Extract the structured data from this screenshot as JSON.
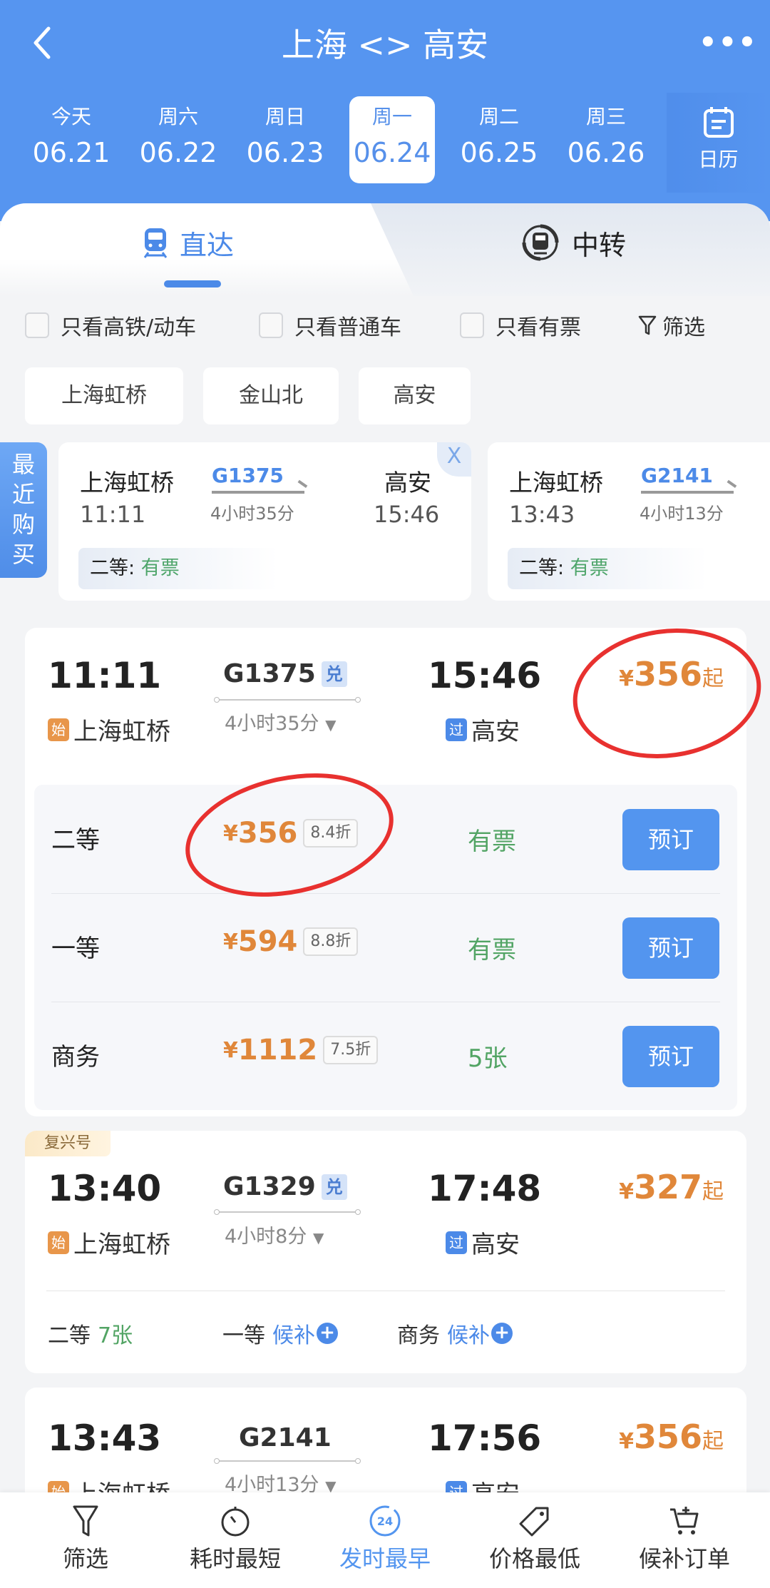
{
  "header": {
    "title": "上海 <> 高安",
    "back_icon": "chevron-left-icon",
    "more_icon": "more-dots-icon",
    "more_label": "•••"
  },
  "dates": [
    {
      "weekday": "今天",
      "date": "06.21",
      "selected": false
    },
    {
      "weekday": "周六",
      "date": "06.22",
      "selected": false
    },
    {
      "weekday": "周日",
      "date": "06.23",
      "selected": false
    },
    {
      "weekday": "周一",
      "date": "06.24",
      "selected": true
    },
    {
      "weekday": "周二",
      "date": "06.25",
      "selected": false
    },
    {
      "weekday": "周三",
      "date": "06.26",
      "selected": false
    }
  ],
  "calendar": {
    "label": "日历",
    "icon": "calendar-icon"
  },
  "tabs": [
    {
      "label": "直达",
      "icon": "train-icon",
      "active": true
    },
    {
      "label": "中转",
      "icon": "transfer-train-icon",
      "active": false
    }
  ],
  "filters": {
    "checkboxes": [
      {
        "label": "只看高铁/动车",
        "checked": false
      },
      {
        "label": "只看普通车",
        "checked": false
      },
      {
        "label": "只看有票",
        "checked": false
      }
    ],
    "filter_label": "筛选"
  },
  "stations": [
    "上海虹桥",
    "金山北",
    "高安"
  ],
  "recent": {
    "tab_label": "最近购买",
    "close_label": "X",
    "items": [
      {
        "from": "上海虹桥",
        "from_time": "11:11",
        "train": "G1375",
        "duration": "4小时35分",
        "to": "高安",
        "to_time": "15:46",
        "seat": "二等:",
        "availability": "有票"
      },
      {
        "from": "上海虹桥",
        "from_time": "13:43",
        "train": "G2141",
        "duration": "4小时13分",
        "seat": "二等:",
        "availability": "有票"
      }
    ]
  },
  "trains": [
    {
      "dep_time": "11:11",
      "train_no": "G1375",
      "tag": "兑",
      "duration": "4小时35分",
      "arr_time": "15:46",
      "from_badge": "始",
      "from": "上海虹桥",
      "to_badge": "过",
      "to": "高安",
      "currency": "¥",
      "price": "356",
      "price_suffix": "起",
      "seats": [
        {
          "class": "二等",
          "currency": "¥",
          "price": "356",
          "discount": "8.4折",
          "availability": "有票",
          "action": "预订"
        },
        {
          "class": "一等",
          "currency": "¥",
          "price": "594",
          "discount": "8.8折",
          "availability": "有票",
          "action": "预订"
        },
        {
          "class": "商务",
          "currency": "¥",
          "price": "1112",
          "discount": "7.5折",
          "availability": "5张",
          "action": "预订"
        }
      ]
    },
    {
      "label": "复兴号",
      "dep_time": "13:40",
      "train_no": "G1329",
      "tag": "兑",
      "duration": "4小时8分",
      "arr_time": "17:48",
      "from_badge": "始",
      "from": "上海虹桥",
      "to_badge": "过",
      "to": "高安",
      "currency": "¥",
      "price": "327",
      "price_suffix": "起",
      "seats_summary": [
        {
          "class": "二等",
          "status": "7张"
        },
        {
          "class": "一等",
          "status": "候补"
        },
        {
          "class": "商务",
          "status": "候补"
        }
      ]
    },
    {
      "dep_time": "13:43",
      "train_no": "G2141",
      "duration": "4小时13分",
      "arr_time": "17:56",
      "from_badge": "始",
      "from": "上海虹桥",
      "to_badge": "过",
      "to": "高安",
      "currency": "¥",
      "price": "356",
      "price_suffix": "起"
    }
  ],
  "bottom_nav": [
    {
      "label": "筛选",
      "icon": "filter-icon",
      "active": false
    },
    {
      "label": "耗时最短",
      "icon": "stopwatch-icon",
      "active": false
    },
    {
      "label": "发时最早",
      "icon": "clock-24-icon",
      "icon_text": "24",
      "active": true
    },
    {
      "label": "价格最低",
      "icon": "price-tag-icon",
      "active": false
    },
    {
      "label": "候补订单",
      "icon": "cart-icon",
      "active": false
    }
  ],
  "colors": {
    "primary": "#5695f0",
    "price": "#e0873a",
    "available": "#52a464",
    "annotation": "#e8312f"
  }
}
